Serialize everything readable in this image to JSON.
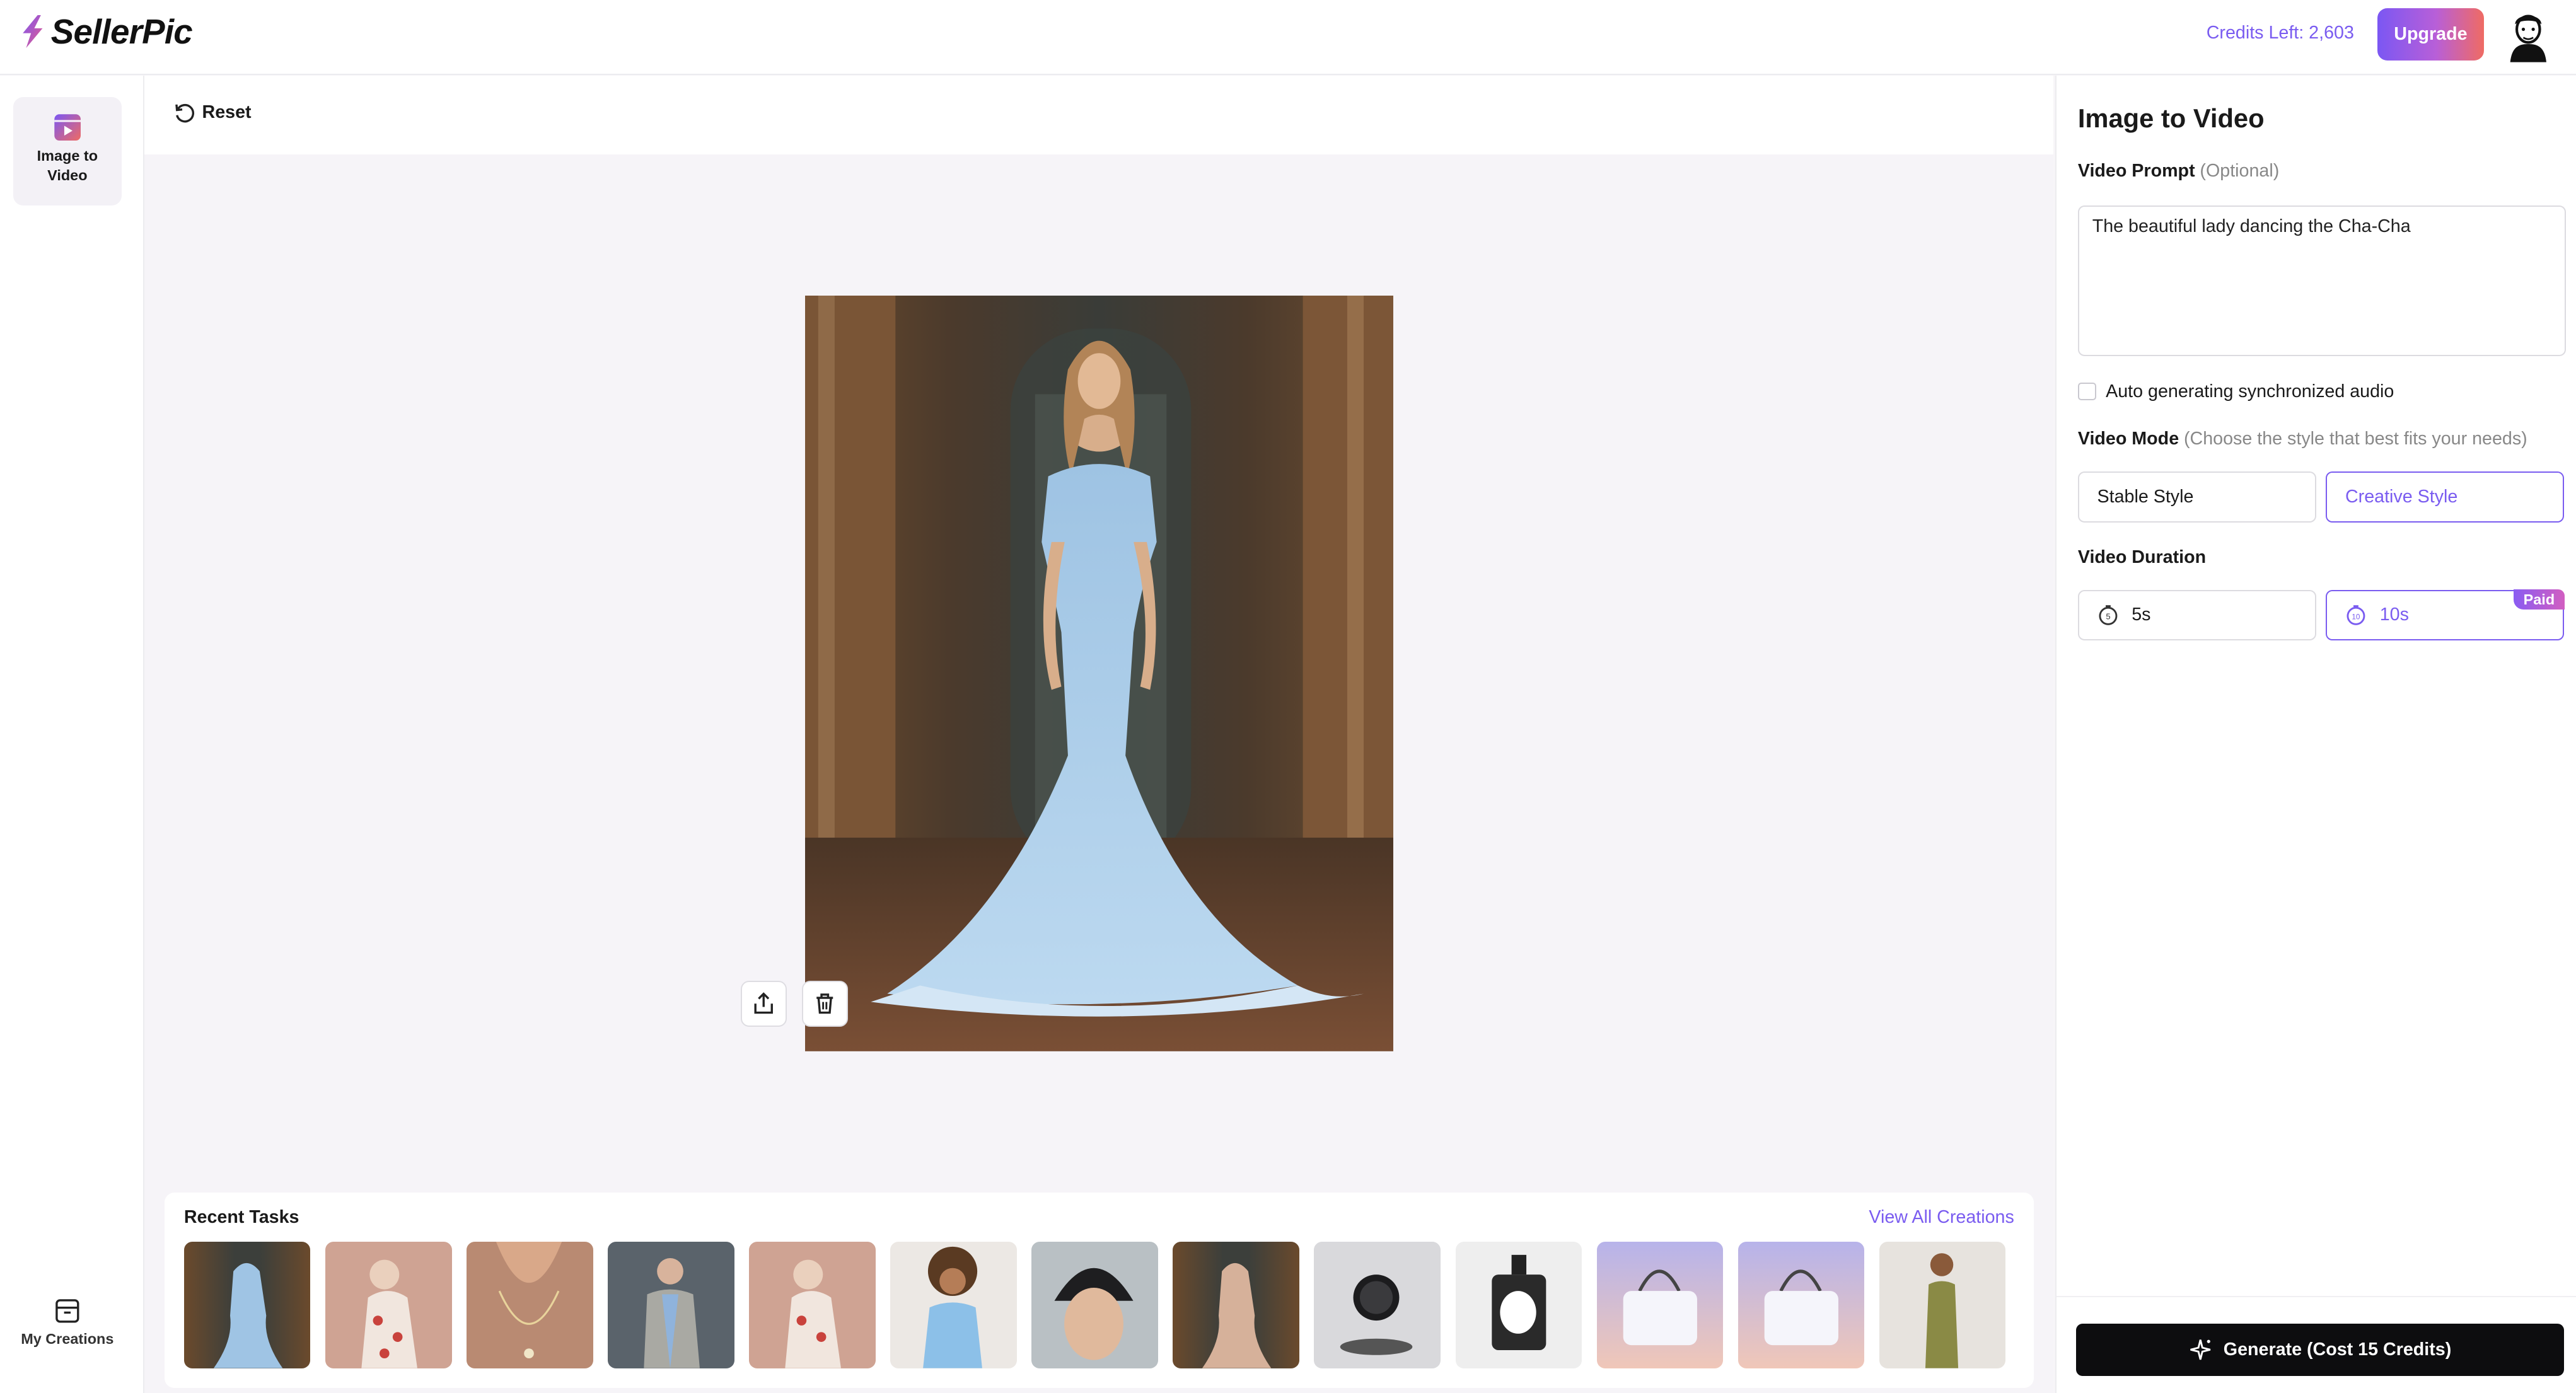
{
  "header": {
    "brand": "SellerPic",
    "credits_text": "Credits Left: 2,603",
    "upgrade_label": "Upgrade"
  },
  "sidebar": {
    "items": [
      {
        "label": "Image to Video",
        "icon": "image-to-video-icon"
      }
    ],
    "bottom": {
      "label": "My Creations",
      "icon": "archive-box-icon"
    }
  },
  "toolbar": {
    "reset_label": "Reset"
  },
  "canvas": {
    "actions": [
      {
        "icon": "upload-icon"
      },
      {
        "icon": "trash-icon"
      }
    ]
  },
  "recent": {
    "title": "Recent Tasks",
    "view_all": "View All Creations",
    "thumbnails": [
      "blue-gown",
      "floral-dress",
      "necklace",
      "street-jacket",
      "floral-dress-2",
      "curly-hair-top",
      "beanie-portrait",
      "beige-gown",
      "watch",
      "perfume",
      "handbag",
      "handbag-2",
      "green-dress"
    ]
  },
  "panel": {
    "title": "Image to Video",
    "prompt_label": "Video Prompt",
    "prompt_hint": "(Optional)",
    "prompt_value": "The beautiful lady dancing the Cha-Cha",
    "audio_label": "Auto generating synchronized audio",
    "mode_label": "Video Mode",
    "mode_hint": "(Choose the style that best fits your needs)",
    "modes": [
      {
        "label": "Stable Style",
        "selected": false
      },
      {
        "label": "Creative Style",
        "selected": true
      }
    ],
    "duration_label": "Video Duration",
    "durations": [
      {
        "label": "5s",
        "selected": false
      },
      {
        "label": "10s",
        "selected": true,
        "badge": "Paid"
      }
    ],
    "generate_label": "Generate (Cost 15 Credits)"
  },
  "colors": {
    "accent": "#7a5cf0",
    "generate_bg": "#0d0d0f"
  }
}
